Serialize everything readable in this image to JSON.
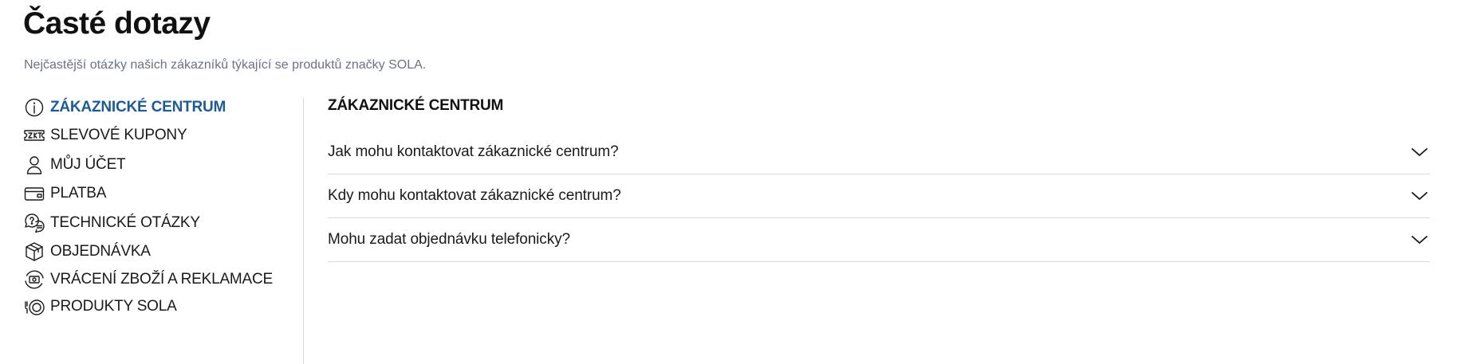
{
  "header": {
    "title": "Časté dotazy",
    "subtitle": "Nejčastější otázky našich zákazníků týkající se produktů značky SOLA."
  },
  "sidebar": {
    "items": [
      {
        "label": "ZÁKAZNICKÉ CENTRUM",
        "icon": "info-bubble-icon",
        "active": true
      },
      {
        "label": "SLEVOVÉ KUPONY",
        "icon": "coupon-icon",
        "active": false
      },
      {
        "label": "MŮJ ÚČET",
        "icon": "user-icon",
        "active": false
      },
      {
        "label": "PLATBA",
        "icon": "card-icon",
        "active": false
      },
      {
        "label": "TECHNICKÉ OTÁZKY",
        "icon": "question-chat-icon",
        "active": false
      },
      {
        "label": "OBJEDNÁVKA",
        "icon": "package-icon",
        "active": false
      },
      {
        "label": "VRÁCENÍ ZBOŽÍ A REKLAMACE",
        "icon": "return-icon",
        "active": false
      },
      {
        "label": "PRODUKTY SOLA",
        "icon": "tableware-icon",
        "active": false
      }
    ]
  },
  "main": {
    "section_title": "ZÁKAZNICKÉ CENTRUM",
    "faqs": [
      {
        "question": "Jak mohu kontaktovat zákaznické centrum?"
      },
      {
        "question": "Kdy mohu kontaktovat zákaznické centrum?"
      },
      {
        "question": "Mohu zadat objednávku telefonicky?"
      }
    ]
  },
  "colors": {
    "active": "#1f5b93",
    "text": "#1a1a1a",
    "muted": "#6b7280",
    "divider": "#d9d9d9"
  }
}
